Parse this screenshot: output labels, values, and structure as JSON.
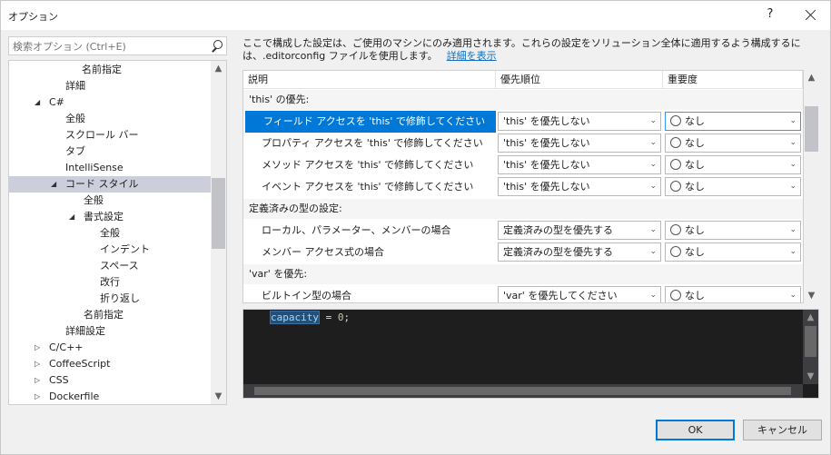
{
  "window": {
    "title": "オプション",
    "help": "?"
  },
  "search": {
    "placeholder": "検索オプション (Ctrl+E)"
  },
  "tree": {
    "items": [
      {
        "label": "名前指定",
        "indent": 80,
        "arrow": ""
      },
      {
        "label": "詳細",
        "indent": 62,
        "arrow": ""
      },
      {
        "label": "C#",
        "indent": 44,
        "arrow": "◢"
      },
      {
        "label": "全般",
        "indent": 62,
        "arrow": ""
      },
      {
        "label": "スクロール バー",
        "indent": 62,
        "arrow": ""
      },
      {
        "label": "タブ",
        "indent": 62,
        "arrow": ""
      },
      {
        "label": "IntelliSense",
        "indent": 62,
        "arrow": ""
      },
      {
        "label": "コード スタイル",
        "indent": 62,
        "arrow": "◢",
        "selected": true
      },
      {
        "label": "全般",
        "indent": 82,
        "arrow": ""
      },
      {
        "label": "書式設定",
        "indent": 82,
        "arrow": "◢"
      },
      {
        "label": "全般",
        "indent": 100,
        "arrow": ""
      },
      {
        "label": "インデント",
        "indent": 100,
        "arrow": ""
      },
      {
        "label": "スペース",
        "indent": 100,
        "arrow": ""
      },
      {
        "label": "改行",
        "indent": 100,
        "arrow": ""
      },
      {
        "label": "折り返し",
        "indent": 100,
        "arrow": ""
      },
      {
        "label": "名前指定",
        "indent": 82,
        "arrow": ""
      },
      {
        "label": "詳細設定",
        "indent": 62,
        "arrow": ""
      },
      {
        "label": "C/C++",
        "indent": 44,
        "arrow": "▷"
      },
      {
        "label": "CoffeeScript",
        "indent": 44,
        "arrow": "▷"
      },
      {
        "label": "CSS",
        "indent": 44,
        "arrow": "▷"
      },
      {
        "label": "Dockerfile",
        "indent": 44,
        "arrow": "▷"
      }
    ]
  },
  "description": {
    "line1": "ここで構成した設定は、ご使用のマシンにのみ適用されます。これらの設定をソリューション全体に適用するよう構成するに",
    "line2": "は、.editorconfig ファイルを使用します。",
    "link": "詳細を表示"
  },
  "grid": {
    "headers": {
      "desc": "説明",
      "pref": "優先順位",
      "sev": "重要度"
    },
    "groups": [
      {
        "title": "'this' の優先:",
        "rows": [
          {
            "label": "フィールド アクセスを 'this' で修飾してください",
            "pref": "'this' を優先しない",
            "sev": "なし",
            "selected": true
          },
          {
            "label": "プロパティ アクセスを 'this' で修飾してください",
            "pref": "'this' を優先しない",
            "sev": "なし"
          },
          {
            "label": "メソッド アクセスを 'this' で修飾してください",
            "pref": "'this' を優先しない",
            "sev": "なし"
          },
          {
            "label": "イベント アクセスを 'this' で修飾してください",
            "pref": "'this' を優先しない",
            "sev": "なし"
          }
        ]
      },
      {
        "title": "定義済みの型の設定:",
        "rows": [
          {
            "label": "ローカル、パラメーター、メンバーの場合",
            "pref": "定義済みの型を優先する",
            "sev": "なし"
          },
          {
            "label": "メンバー アクセス式の場合",
            "pref": "定義済みの型を優先する",
            "sev": "なし"
          }
        ]
      },
      {
        "title": "'var' を優先:",
        "rows": [
          {
            "label": "ビルトイン型の場合",
            "pref": "'var' を優先してください",
            "sev": "なし"
          }
        ]
      }
    ]
  },
  "preview": {
    "code_ident": "capacity",
    "code_op": " = ",
    "code_num": "0",
    "code_end": ";"
  },
  "buttons": {
    "ok": "OK",
    "cancel": "キャンセル"
  }
}
